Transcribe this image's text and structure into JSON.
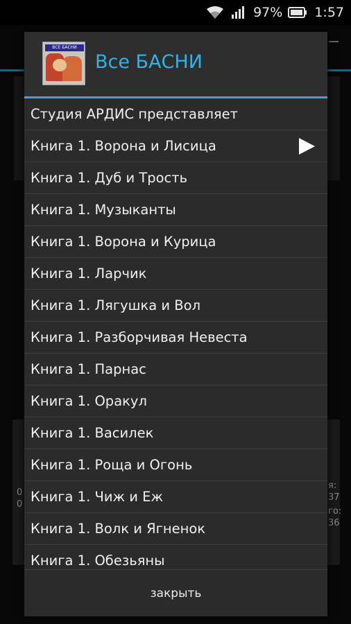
{
  "status_bar": {
    "battery_percent": "97%",
    "time": "1:57"
  },
  "background": {
    "left_text_1": "0",
    "left_text_2": "0",
    "right_text_1": "я:",
    "right_text_2": "37",
    "right_text_3": "го:",
    "right_text_4": "36"
  },
  "dialog": {
    "title": "Все БАСНИ",
    "cover_text": "ВСЕ БАСНИ",
    "items": [
      {
        "label": "Студия АРДИС представляет",
        "playing": false
      },
      {
        "label": "Книга 1. Ворона и Лисица",
        "playing": true
      },
      {
        "label": "Книга 1. Дуб и Трость",
        "playing": false
      },
      {
        "label": "Книга 1. Музыканты",
        "playing": false
      },
      {
        "label": "Книга 1. Ворона и Курица",
        "playing": false
      },
      {
        "label": "Книга 1. Ларчик",
        "playing": false
      },
      {
        "label": "Книга 1. Лягушка и Вол",
        "playing": false
      },
      {
        "label": "Книга 1. Разборчивая Невеста",
        "playing": false
      },
      {
        "label": "Книга 1. Парнас",
        "playing": false
      },
      {
        "label": "Книга 1. Оракул",
        "playing": false
      },
      {
        "label": "Книга 1. Василек",
        "playing": false
      },
      {
        "label": "Книга 1. Роща и Огонь",
        "playing": false
      },
      {
        "label": "Книга 1. Чиж и Еж",
        "playing": false
      },
      {
        "label": "Книга 1. Волк и Ягненок",
        "playing": false
      },
      {
        "label": "Книга 1. Обезьяны",
        "playing": false
      }
    ],
    "close_label": "закрыть"
  }
}
